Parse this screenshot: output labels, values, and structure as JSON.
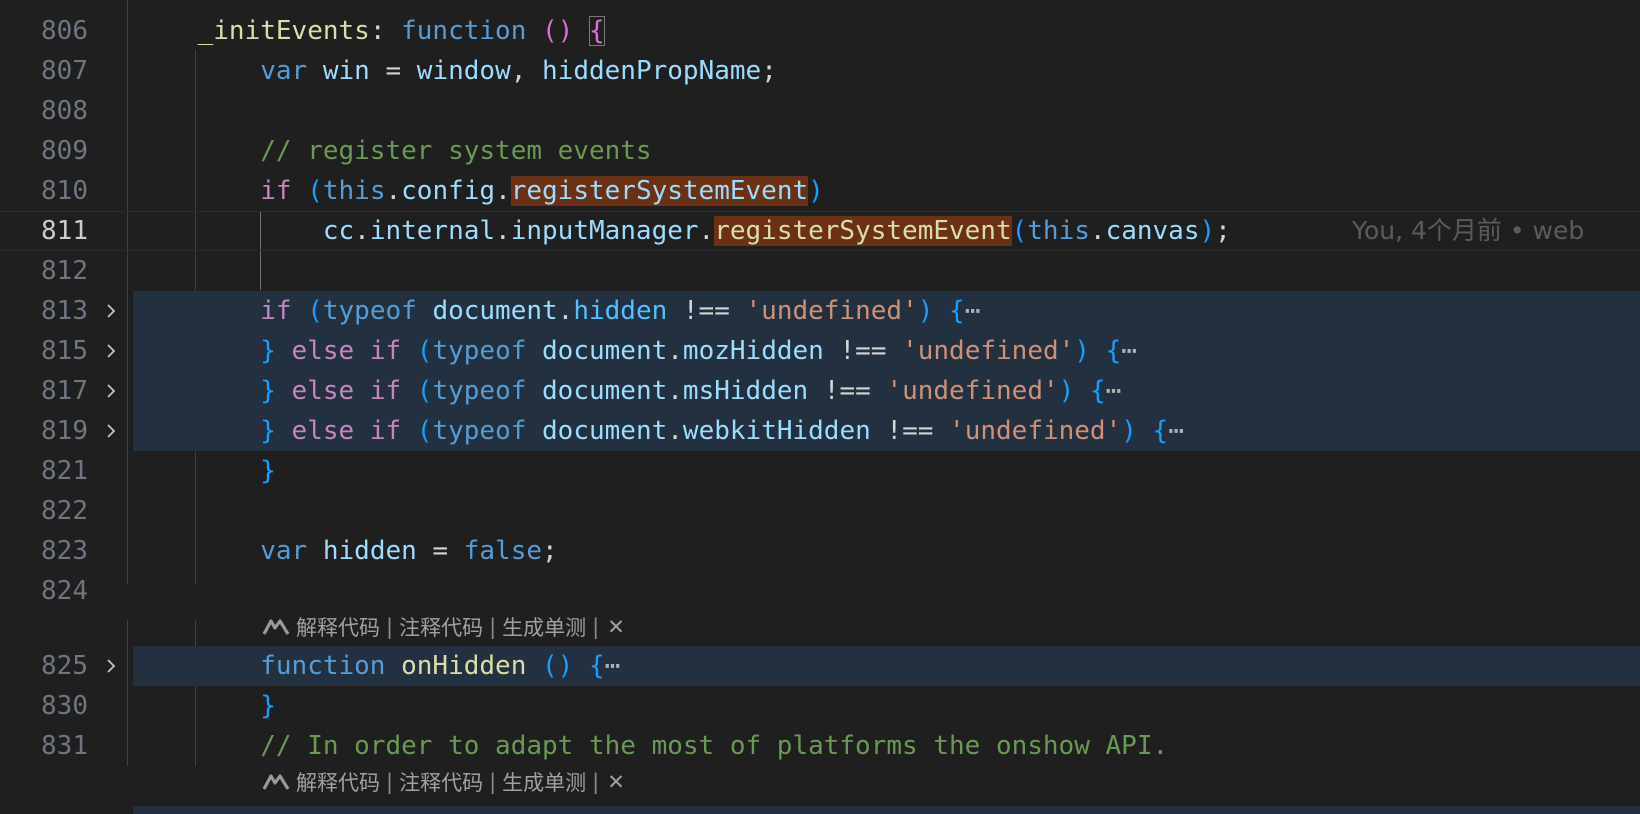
{
  "editor": {
    "lines": [
      {
        "num": "806"
      },
      {
        "num": "807"
      },
      {
        "num": "808"
      },
      {
        "num": "809"
      },
      {
        "num": "810"
      },
      {
        "num": "811"
      },
      {
        "num": "812"
      },
      {
        "num": "813"
      },
      {
        "num": "815"
      },
      {
        "num": "817"
      },
      {
        "num": "819"
      },
      {
        "num": "821"
      },
      {
        "num": "822"
      },
      {
        "num": "823"
      },
      {
        "num": "824"
      },
      {
        "num": "825"
      },
      {
        "num": "830"
      },
      {
        "num": "831"
      }
    ],
    "tokens": {
      "initEvents": "_initEvents",
      "colon": ": ",
      "function_kw": "function",
      "sp": " ",
      "lparen": "(",
      "rparen": ")",
      "lbrace": "{",
      "rbrace": "}",
      "var_kw": "var",
      "win": "win",
      "eq": " = ",
      "window": "window",
      "comma_sp": ", ",
      "hiddenPropName": "hiddenPropName",
      "semicolon": ";",
      "comment_register": "// register system events",
      "if_kw": "if",
      "this_kw": "this",
      "dot": ".",
      "config": "config",
      "registerSystemEvent": "registerSystemEvent",
      "cc": "cc",
      "internal": "internal",
      "inputManager": "inputManager",
      "canvas": "canvas",
      "else_kw": "else",
      "typeof_kw": "typeof",
      "document": "document",
      "hidden": "hidden",
      "mozHidden": "mozHidden",
      "msHidden": "msHidden",
      "webkitHidden": "webkitHidden",
      "neq": " !== ",
      "undefined_str": "'undefined'",
      "ellipsis": "⋯",
      "hidden_var": "hidden",
      "false_kw": "false",
      "onHidden": "onHidden",
      "comment_adapt": "// In order to adapt the most of platforms the onshow API."
    },
    "blame": "You, 4个月前 • web",
    "codelens": {
      "logo_icon": "marscode-logo-icon",
      "explain": "解释代码",
      "comment": "注释代码",
      "test": "生成单测",
      "separator": "|",
      "close": "✕"
    }
  }
}
